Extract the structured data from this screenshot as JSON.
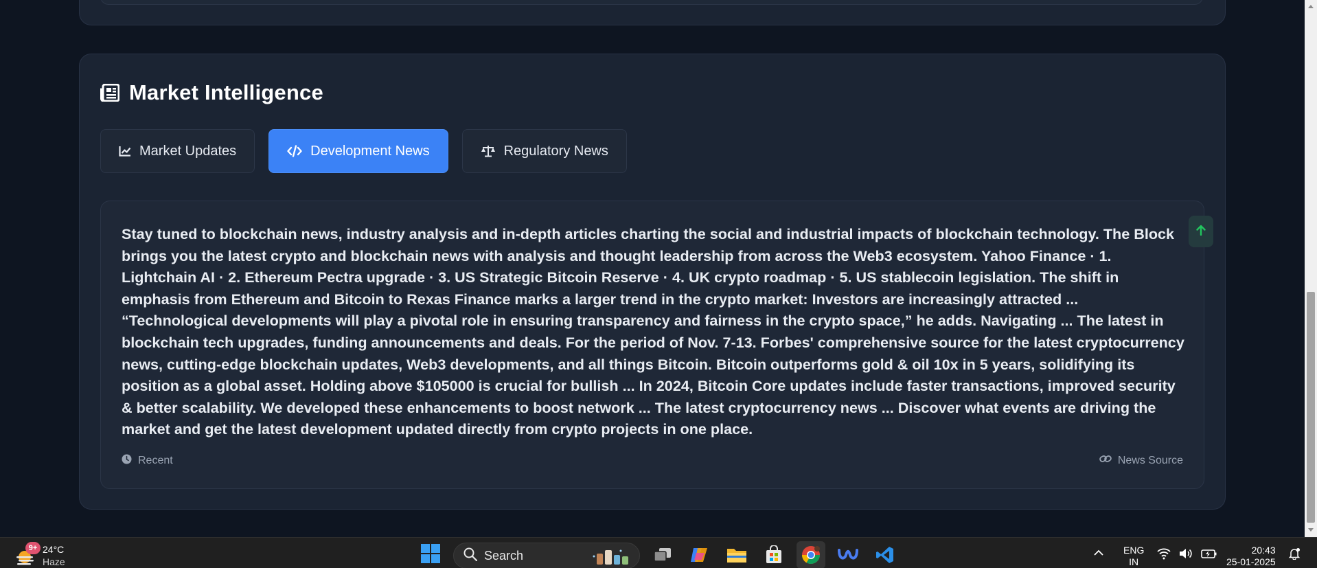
{
  "section": {
    "title": "Market Intelligence",
    "icon": "newspaper-icon"
  },
  "tabs": [
    {
      "label": "Market Updates",
      "icon": "chart-line-icon",
      "active": false
    },
    {
      "label": "Development News",
      "icon": "code-icon",
      "active": true
    },
    {
      "label": "Regulatory News",
      "icon": "scale-icon",
      "active": false
    }
  ],
  "news": {
    "body": "Stay tuned to blockchain news, industry analysis and in-depth articles charting the social and industrial impacts of blockchain technology. The Block brings you the latest crypto and blockchain news with analysis and thought leadership from across the Web3 ecosystem. Yahoo Finance · 1. Lightchain AI · 2. Ethereum Pectra upgrade · 3. US Strategic Bitcoin Reserve · 4. UK crypto roadmap · 5. US stablecoin legislation. The shift in emphasis from Ethereum and Bitcoin to Rexas Finance marks a larger trend in the crypto market: Investors are increasingly attracted ... “Technological developments will play a pivotal role in ensuring transparency and fairness in the crypto space,” he adds. Navigating ... The latest in blockchain tech upgrades, funding announcements and deals. For the period of Nov. 7-13. Forbes' comprehensive source for the latest cryptocurrency news, cutting-edge blockchain updates, Web3 developments, and all things Bitcoin. Bitcoin outperforms gold & oil 10x in 5 years, solidifying its position as a global asset. Holding above $105000 is crucial for bullish ... In 2024, Bitcoin Core updates include faster transactions, improved security & better scalability. We developed these enhancements to boost network ... The latest cryptocurrency news ... Discover what events are driving the market and get the latest development updated directly from crypto projects in one place.",
    "time_label": "Recent",
    "source_label": "News Source"
  },
  "taskbar": {
    "weather": {
      "temp": "24°C",
      "condition": "Haze",
      "badge": "9+"
    },
    "search_placeholder": "Search",
    "language": {
      "line1": "ENG",
      "line2": "IN"
    },
    "clock": {
      "time": "20:43",
      "date": "25-01-2025"
    }
  },
  "colors": {
    "page_bg": "#0e1521",
    "card_bg": "#1b2433",
    "accent": "#3b82f6",
    "scroll_top_accent": "#22c55e"
  }
}
